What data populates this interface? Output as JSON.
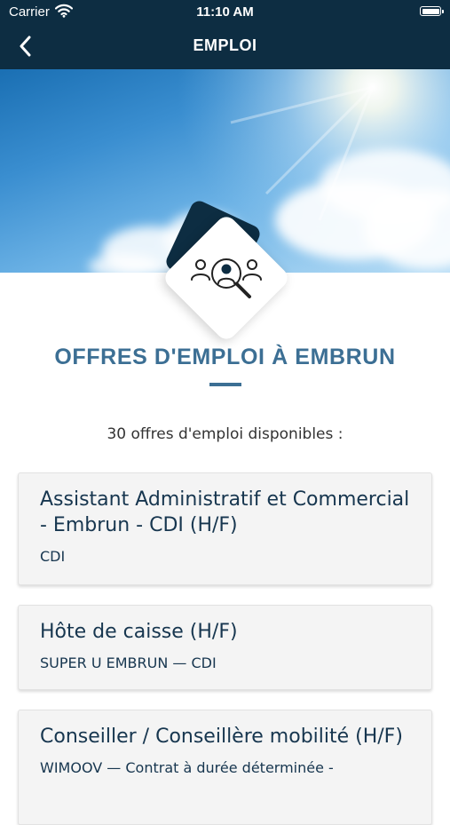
{
  "status_bar": {
    "carrier": "Carrier",
    "time": "11:10 AM",
    "battery_level": 1.0
  },
  "nav": {
    "title": "EMPLOI",
    "back_icon": "chevron-left-icon",
    "background_color": "#0d2d42"
  },
  "hero": {
    "badge_icon": "people-search-icon"
  },
  "section": {
    "heading": "OFFRES D'EMPLOI À EMBRUN",
    "count_text": "30 offres d'emploi disponibles :",
    "accent_color": "#3c6f94"
  },
  "jobs": [
    {
      "title": "Assistant Administratif et Commercial - Embrun - CDI (H/F)",
      "subtitle": "CDI"
    },
    {
      "title": "Hôte de caisse (H/F)",
      "subtitle": "SUPER U EMBRUN — CDI"
    },
    {
      "title": "Conseiller / Conseillère mobilité (H/F)",
      "subtitle": "WIMOOV — Contrat à durée déterminée -"
    }
  ]
}
